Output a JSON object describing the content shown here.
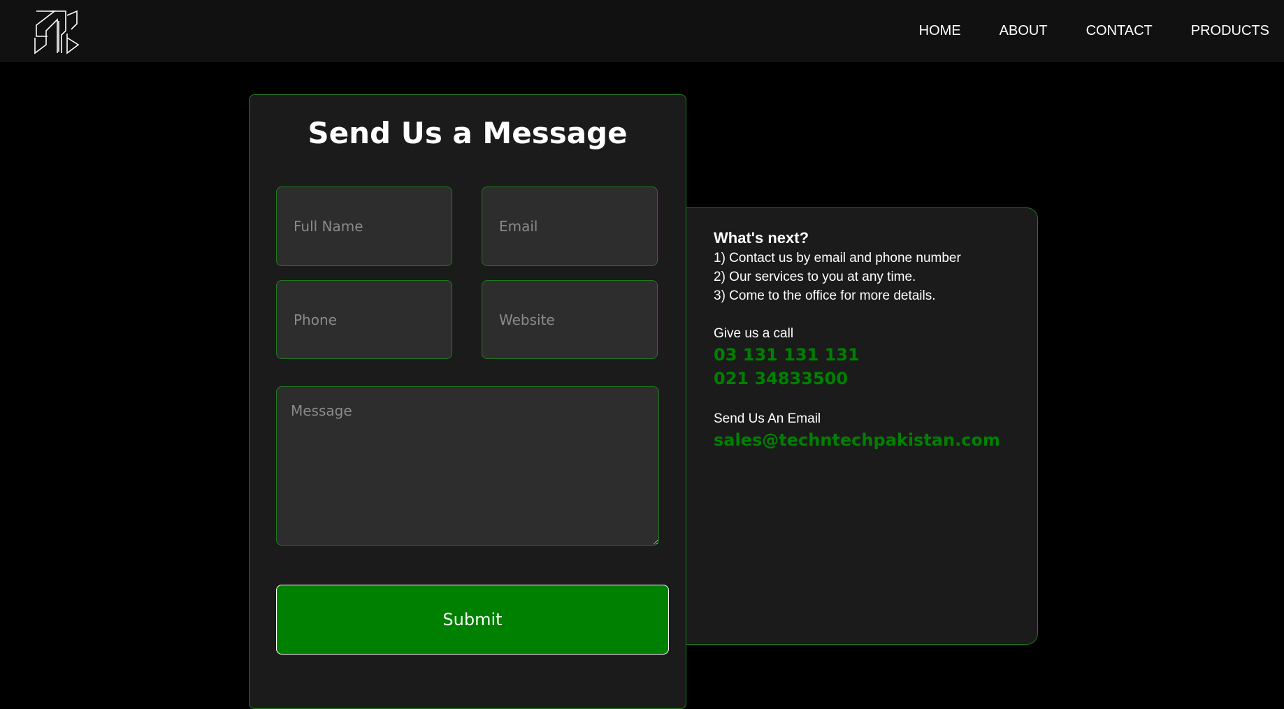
{
  "nav": {
    "items": [
      "HOME",
      "ABOUT",
      "CONTACT",
      "PRODUCTS"
    ]
  },
  "form": {
    "title": "Send Us a Message",
    "full_name_placeholder": "Full Name",
    "email_placeholder": "Email",
    "phone_placeholder": "Phone",
    "website_placeholder": "Website",
    "message_placeholder": "Message",
    "submit_label": "Submit"
  },
  "info": {
    "heading": "What's next?",
    "steps": [
      "1) Contact us by email and phone number",
      "2) Our services to you at any time.",
      "3) Come to the office for more details."
    ],
    "call_label": "Give us a call",
    "phones": [
      "03 131 131 131",
      "021 34833500"
    ],
    "email_label": "Send Us An Email",
    "email": "sales@techntechpakistan.com"
  },
  "colors": {
    "accent": "#008000",
    "border": "#1f7a1f",
    "card_bg": "#1b1b1b",
    "field_bg": "#2d2d2d",
    "nav_bg": "#111111"
  },
  "icons": {
    "logo": "brand-logo-icon"
  }
}
